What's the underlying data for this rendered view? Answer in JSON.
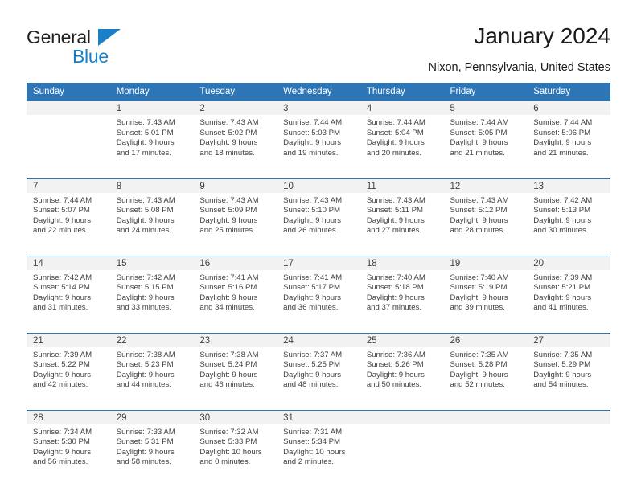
{
  "brand": {
    "name_part1": "General",
    "name_part2": "Blue",
    "accent_color": "#1a7fc6"
  },
  "header": {
    "title": "January 2024",
    "location": "Nixon, Pennsylvania, United States",
    "header_bg_color": "#2e75b6"
  },
  "weekdays": [
    "Sunday",
    "Monday",
    "Tuesday",
    "Wednesday",
    "Thursday",
    "Friday",
    "Saturday"
  ],
  "weeks": [
    [
      {
        "day": "",
        "sunrise": "",
        "sunset": "",
        "daylight_line1": "",
        "daylight_line2": ""
      },
      {
        "day": "1",
        "sunrise": "Sunrise: 7:43 AM",
        "sunset": "Sunset: 5:01 PM",
        "daylight_line1": "Daylight: 9 hours",
        "daylight_line2": "and 17 minutes."
      },
      {
        "day": "2",
        "sunrise": "Sunrise: 7:43 AM",
        "sunset": "Sunset: 5:02 PM",
        "daylight_line1": "Daylight: 9 hours",
        "daylight_line2": "and 18 minutes."
      },
      {
        "day": "3",
        "sunrise": "Sunrise: 7:44 AM",
        "sunset": "Sunset: 5:03 PM",
        "daylight_line1": "Daylight: 9 hours",
        "daylight_line2": "and 19 minutes."
      },
      {
        "day": "4",
        "sunrise": "Sunrise: 7:44 AM",
        "sunset": "Sunset: 5:04 PM",
        "daylight_line1": "Daylight: 9 hours",
        "daylight_line2": "and 20 minutes."
      },
      {
        "day": "5",
        "sunrise": "Sunrise: 7:44 AM",
        "sunset": "Sunset: 5:05 PM",
        "daylight_line1": "Daylight: 9 hours",
        "daylight_line2": "and 21 minutes."
      },
      {
        "day": "6",
        "sunrise": "Sunrise: 7:44 AM",
        "sunset": "Sunset: 5:06 PM",
        "daylight_line1": "Daylight: 9 hours",
        "daylight_line2": "and 21 minutes."
      }
    ],
    [
      {
        "day": "7",
        "sunrise": "Sunrise: 7:44 AM",
        "sunset": "Sunset: 5:07 PM",
        "daylight_line1": "Daylight: 9 hours",
        "daylight_line2": "and 22 minutes."
      },
      {
        "day": "8",
        "sunrise": "Sunrise: 7:43 AM",
        "sunset": "Sunset: 5:08 PM",
        "daylight_line1": "Daylight: 9 hours",
        "daylight_line2": "and 24 minutes."
      },
      {
        "day": "9",
        "sunrise": "Sunrise: 7:43 AM",
        "sunset": "Sunset: 5:09 PM",
        "daylight_line1": "Daylight: 9 hours",
        "daylight_line2": "and 25 minutes."
      },
      {
        "day": "10",
        "sunrise": "Sunrise: 7:43 AM",
        "sunset": "Sunset: 5:10 PM",
        "daylight_line1": "Daylight: 9 hours",
        "daylight_line2": "and 26 minutes."
      },
      {
        "day": "11",
        "sunrise": "Sunrise: 7:43 AM",
        "sunset": "Sunset: 5:11 PM",
        "daylight_line1": "Daylight: 9 hours",
        "daylight_line2": "and 27 minutes."
      },
      {
        "day": "12",
        "sunrise": "Sunrise: 7:43 AM",
        "sunset": "Sunset: 5:12 PM",
        "daylight_line1": "Daylight: 9 hours",
        "daylight_line2": "and 28 minutes."
      },
      {
        "day": "13",
        "sunrise": "Sunrise: 7:42 AM",
        "sunset": "Sunset: 5:13 PM",
        "daylight_line1": "Daylight: 9 hours",
        "daylight_line2": "and 30 minutes."
      }
    ],
    [
      {
        "day": "14",
        "sunrise": "Sunrise: 7:42 AM",
        "sunset": "Sunset: 5:14 PM",
        "daylight_line1": "Daylight: 9 hours",
        "daylight_line2": "and 31 minutes."
      },
      {
        "day": "15",
        "sunrise": "Sunrise: 7:42 AM",
        "sunset": "Sunset: 5:15 PM",
        "daylight_line1": "Daylight: 9 hours",
        "daylight_line2": "and 33 minutes."
      },
      {
        "day": "16",
        "sunrise": "Sunrise: 7:41 AM",
        "sunset": "Sunset: 5:16 PM",
        "daylight_line1": "Daylight: 9 hours",
        "daylight_line2": "and 34 minutes."
      },
      {
        "day": "17",
        "sunrise": "Sunrise: 7:41 AM",
        "sunset": "Sunset: 5:17 PM",
        "daylight_line1": "Daylight: 9 hours",
        "daylight_line2": "and 36 minutes."
      },
      {
        "day": "18",
        "sunrise": "Sunrise: 7:40 AM",
        "sunset": "Sunset: 5:18 PM",
        "daylight_line1": "Daylight: 9 hours",
        "daylight_line2": "and 37 minutes."
      },
      {
        "day": "19",
        "sunrise": "Sunrise: 7:40 AM",
        "sunset": "Sunset: 5:19 PM",
        "daylight_line1": "Daylight: 9 hours",
        "daylight_line2": "and 39 minutes."
      },
      {
        "day": "20",
        "sunrise": "Sunrise: 7:39 AM",
        "sunset": "Sunset: 5:21 PM",
        "daylight_line1": "Daylight: 9 hours",
        "daylight_line2": "and 41 minutes."
      }
    ],
    [
      {
        "day": "21",
        "sunrise": "Sunrise: 7:39 AM",
        "sunset": "Sunset: 5:22 PM",
        "daylight_line1": "Daylight: 9 hours",
        "daylight_line2": "and 42 minutes."
      },
      {
        "day": "22",
        "sunrise": "Sunrise: 7:38 AM",
        "sunset": "Sunset: 5:23 PM",
        "daylight_line1": "Daylight: 9 hours",
        "daylight_line2": "and 44 minutes."
      },
      {
        "day": "23",
        "sunrise": "Sunrise: 7:38 AM",
        "sunset": "Sunset: 5:24 PM",
        "daylight_line1": "Daylight: 9 hours",
        "daylight_line2": "and 46 minutes."
      },
      {
        "day": "24",
        "sunrise": "Sunrise: 7:37 AM",
        "sunset": "Sunset: 5:25 PM",
        "daylight_line1": "Daylight: 9 hours",
        "daylight_line2": "and 48 minutes."
      },
      {
        "day": "25",
        "sunrise": "Sunrise: 7:36 AM",
        "sunset": "Sunset: 5:26 PM",
        "daylight_line1": "Daylight: 9 hours",
        "daylight_line2": "and 50 minutes."
      },
      {
        "day": "26",
        "sunrise": "Sunrise: 7:35 AM",
        "sunset": "Sunset: 5:28 PM",
        "daylight_line1": "Daylight: 9 hours",
        "daylight_line2": "and 52 minutes."
      },
      {
        "day": "27",
        "sunrise": "Sunrise: 7:35 AM",
        "sunset": "Sunset: 5:29 PM",
        "daylight_line1": "Daylight: 9 hours",
        "daylight_line2": "and 54 minutes."
      }
    ],
    [
      {
        "day": "28",
        "sunrise": "Sunrise: 7:34 AM",
        "sunset": "Sunset: 5:30 PM",
        "daylight_line1": "Daylight: 9 hours",
        "daylight_line2": "and 56 minutes."
      },
      {
        "day": "29",
        "sunrise": "Sunrise: 7:33 AM",
        "sunset": "Sunset: 5:31 PM",
        "daylight_line1": "Daylight: 9 hours",
        "daylight_line2": "and 58 minutes."
      },
      {
        "day": "30",
        "sunrise": "Sunrise: 7:32 AM",
        "sunset": "Sunset: 5:33 PM",
        "daylight_line1": "Daylight: 10 hours",
        "daylight_line2": "and 0 minutes."
      },
      {
        "day": "31",
        "sunrise": "Sunrise: 7:31 AM",
        "sunset": "Sunset: 5:34 PM",
        "daylight_line1": "Daylight: 10 hours",
        "daylight_line2": "and 2 minutes."
      },
      {
        "day": "",
        "sunrise": "",
        "sunset": "",
        "daylight_line1": "",
        "daylight_line2": ""
      },
      {
        "day": "",
        "sunrise": "",
        "sunset": "",
        "daylight_line1": "",
        "daylight_line2": ""
      },
      {
        "day": "",
        "sunrise": "",
        "sunset": "",
        "daylight_line1": "",
        "daylight_line2": ""
      }
    ]
  ]
}
